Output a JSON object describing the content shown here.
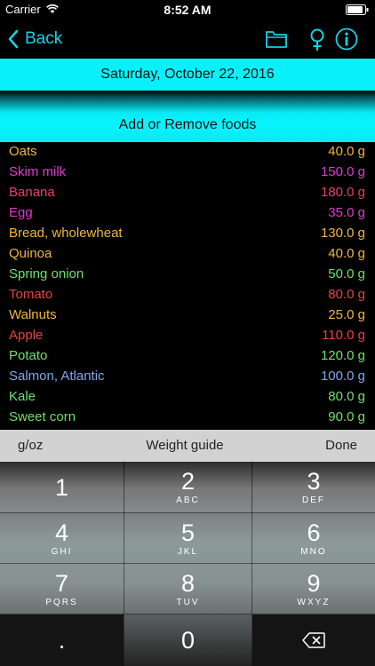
{
  "status_bar": {
    "carrier": "Carrier",
    "time": "8:52 AM"
  },
  "nav": {
    "back_label": "Back",
    "accent_color": "#13d3e6",
    "icons": [
      "folder-icon",
      "female-icon",
      "info-icon"
    ]
  },
  "date": "Saturday, October 22, 2016",
  "add_remove_label": "Add or Remove foods",
  "foods": [
    {
      "name": "Oats",
      "weight": "40.0 g",
      "color": "#f0b540"
    },
    {
      "name": "Skim milk",
      "weight": "150.0 g",
      "color": "#e03ad0"
    },
    {
      "name": "Banana",
      "weight": "180.0 g",
      "color": "#ec3a6c"
    },
    {
      "name": "Egg",
      "weight": "35.0 g",
      "color": "#e03ad0"
    },
    {
      "name": "Bread, wholewheat",
      "weight": "130.0 g",
      "color": "#f0b540"
    },
    {
      "name": "Quinoa",
      "weight": "40.0 g",
      "color": "#f0b540"
    },
    {
      "name": "Spring onion",
      "weight": "50.0 g",
      "color": "#6ee06a"
    },
    {
      "name": "Tomato",
      "weight": "80.0 g",
      "color": "#e84242"
    },
    {
      "name": "Walnuts",
      "weight": "25.0 g",
      "color": "#f0b540"
    },
    {
      "name": "Apple",
      "weight": "110.0 g",
      "color": "#e84242"
    },
    {
      "name": "Potato",
      "weight": "120.0 g",
      "color": "#6ee06a"
    },
    {
      "name": "Salmon, Atlantic",
      "weight": "100.0 g",
      "color": "#7fa8ec"
    },
    {
      "name": "Kale",
      "weight": "80.0 g",
      "color": "#6ee06a"
    },
    {
      "name": "Sweet corn",
      "weight": "90.0 g",
      "color": "#6ee06a"
    }
  ],
  "accessory": {
    "units": "g/oz",
    "guide": "Weight guide",
    "done": "Done"
  },
  "keypad": [
    {
      "digit": "1",
      "letters": ""
    },
    {
      "digit": "2",
      "letters": "ABC"
    },
    {
      "digit": "3",
      "letters": "DEF"
    },
    {
      "digit": "4",
      "letters": "GHI"
    },
    {
      "digit": "5",
      "letters": "JKL"
    },
    {
      "digit": "6",
      "letters": "MNO"
    },
    {
      "digit": "7",
      "letters": "PQRS"
    },
    {
      "digit": "8",
      "letters": "TUV"
    },
    {
      "digit": "9",
      "letters": "WXYZ"
    },
    {
      "digit": ".",
      "letters": ""
    },
    {
      "digit": "0",
      "letters": ""
    }
  ]
}
